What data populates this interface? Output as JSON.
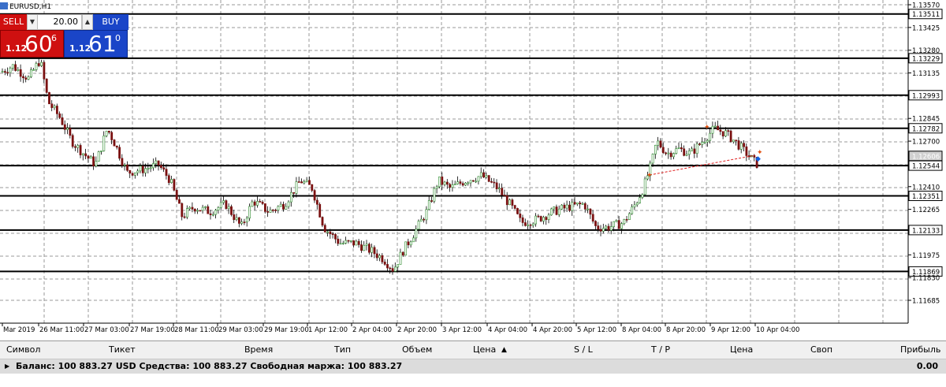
{
  "chart": {
    "symbol": "EURUSD,H1",
    "price_levels": [
      "1.13570",
      "1.13511",
      "1.13425",
      "1.13280",
      "1.13229",
      "1.13135",
      "1.12993",
      "1.12845",
      "1.12782",
      "1.12700",
      "1.12606",
      "1.12544",
      "1.12410",
      "1.12351",
      "1.12265",
      "1.12133",
      "1.11975",
      "1.11869",
      "1.11830",
      "1.11685"
    ],
    "time_labels": [
      "Mar 2019",
      "26 Mar 11:00",
      "27 Mar 03:00",
      "27 Mar 19:00",
      "28 Mar 11:00",
      "29 Mar 03:00",
      "29 Mar 19:00",
      "1 Apr 12:00",
      "2 Apr 04:00",
      "2 Apr 20:00",
      "3 Apr 12:00",
      "4 Apr 04:00",
      "4 Apr 20:00",
      "5 Apr 12:00",
      "8 Apr 04:00",
      "8 Apr 20:00",
      "9 Apr 12:00",
      "10 Apr 04:00"
    ],
    "bid_color": "#d0d0d0",
    "bull_color": "#2a8a2a",
    "bear_color": "#7a1010"
  },
  "trade_panel": {
    "sell_label": "SELL",
    "buy_label": "BUY",
    "lot": "20.00",
    "dropdown_icon": "chevron-down",
    "up_icon": "chevron-up",
    "sell_small": "1.12",
    "sell_big": "60",
    "sell_sup": "6",
    "buy_small": "1.12",
    "buy_big": "61",
    "buy_sup": "0"
  },
  "terminal": {
    "columns": [
      "Символ",
      "Тикет",
      "Время",
      "Тип",
      "Объем",
      "Цена",
      "S / L",
      "T / P",
      "Цена",
      "Своп",
      "Прибыль"
    ],
    "sort_icon": "sort-up",
    "balance_text": "Баланс: 100 883.27 USD  Средства: 100 883.27  Свободная маржа: 100 883.27",
    "profit": "0.00"
  }
}
